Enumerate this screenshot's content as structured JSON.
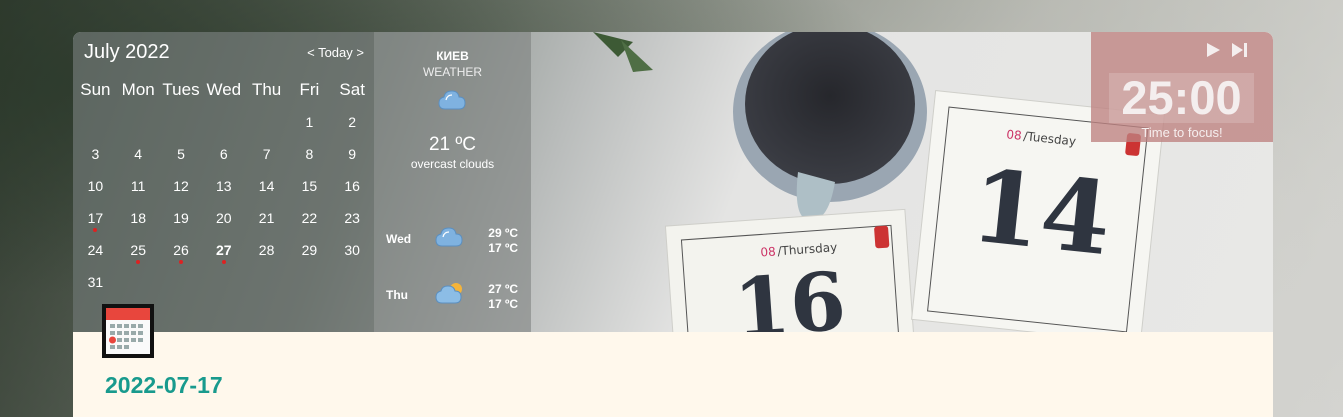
{
  "calendar": {
    "month_title": "July 2022",
    "nav_prev": "<",
    "nav_today": "Today",
    "nav_next": ">",
    "weekdays": [
      "Sun",
      "Mon",
      "Tues",
      "Wed",
      "Thu",
      "Fri",
      "Sat"
    ],
    "weeks": [
      [
        "",
        "",
        "",
        "",
        "",
        "1",
        "2"
      ],
      [
        "3",
        "4",
        "5",
        "6",
        "7",
        "8",
        "9"
      ],
      [
        "10",
        "11",
        "12",
        "13",
        "14",
        "15",
        "16"
      ],
      [
        "17",
        "18",
        "19",
        "20",
        "21",
        "22",
        "23"
      ],
      [
        "24",
        "25",
        "26",
        "27",
        "28",
        "29",
        "30"
      ],
      [
        "31",
        "",
        "",
        "",
        "",
        "",
        ""
      ]
    ],
    "marked_days": [
      "17",
      "25",
      "26",
      "27"
    ],
    "today": "27"
  },
  "weather": {
    "city": "КИЕВ",
    "label": "WEATHER",
    "icon": "cloud-icon",
    "temp": "21 ºC",
    "description": "overcast clouds",
    "forecast": [
      {
        "day": "Wed",
        "hi": "29 ºC",
        "lo": "17 ºC",
        "icon": "cloud-icon"
      },
      {
        "day": "Thu",
        "hi": "27 ºC",
        "lo": "17 ºC",
        "icon": "sun-cloud-icon"
      }
    ]
  },
  "pomodoro": {
    "time": "25:00",
    "label": "Time to focus!"
  },
  "page": {
    "date": "2022-07-17"
  },
  "colors": {
    "accent": "#189a8d",
    "marker": "#dd2222",
    "pomodoro_bg": "#be8280"
  }
}
